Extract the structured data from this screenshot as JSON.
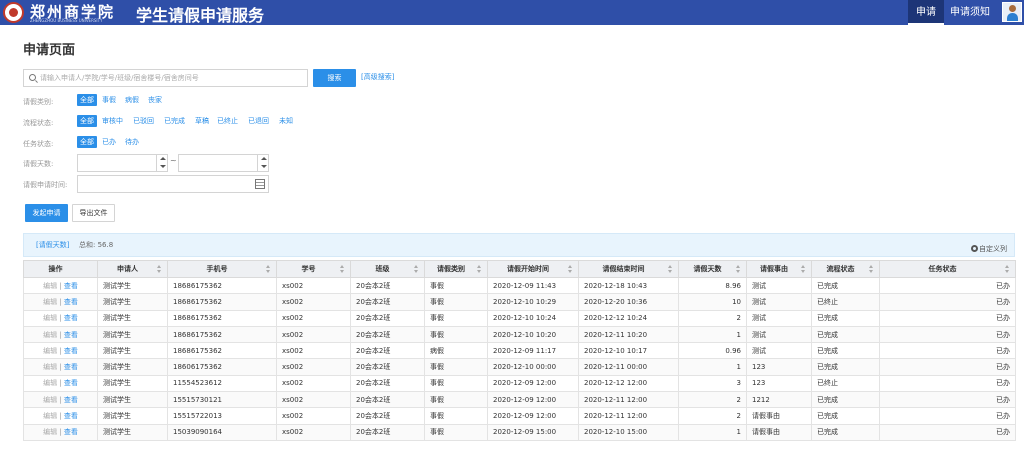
{
  "header": {
    "logo_text": "郑州商学院",
    "logo_subtitle": "ZHENGZHOU BUSINESS UNIVERSITY",
    "app_title": "学生请假申请服务",
    "nav": [
      {
        "label": "申请",
        "active": true
      },
      {
        "label": "申请须知",
        "active": false
      }
    ],
    "brand_color": "#2f4fa8"
  },
  "page": {
    "title": "申请页面",
    "search": {
      "placeholder": "请输入申请人/学院/学号/班级/宿舍楼号/宿舍房间号",
      "button": "搜索",
      "advanced": "[高级搜索]"
    },
    "filters": {
      "leave_type": {
        "label": "请假类别:",
        "options": [
          "全部",
          "事假",
          "病假",
          "丧家"
        ],
        "selected": "全部"
      },
      "flow_status": {
        "label": "流程状态:",
        "options": [
          "全部",
          "审核中",
          "已驳回",
          "已完成",
          "草稿",
          "已终止",
          "已退回",
          "未知"
        ],
        "selected": "全部"
      },
      "task_status": {
        "label": "任务状态:",
        "options": [
          "全部",
          "已办",
          "待办"
        ],
        "selected": "全部"
      },
      "leave_days": {
        "label": "请假天数:",
        "range_separator": "~"
      },
      "apply_time": {
        "label": "请假申请时间:"
      }
    },
    "actions": {
      "apply": "发起申请",
      "export": "导出文件"
    },
    "summary": {
      "link": "[请假天数]",
      "total": "总和: 56.8",
      "custom_columns": "自定义列"
    },
    "table": {
      "columns": [
        "操作",
        "申请人",
        "手机号",
        "学号",
        "班级",
        "请假类别",
        "请假开始时间",
        "请假结束时间",
        "请假天数",
        "请假事由",
        "流程状态",
        "任务状态"
      ],
      "op_edit": "编辑",
      "op_sep": "|",
      "op_view": "查看",
      "rows": [
        [
          "测试学生",
          "18686175362",
          "xs002",
          "20会本2班",
          "事假",
          "2020-12-09 11:43",
          "2020-12-18 10:43",
          "8.96",
          "测试",
          "已完成",
          "已办"
        ],
        [
          "测试学生",
          "18686175362",
          "xs002",
          "20会本2班",
          "事假",
          "2020-12-10 10:29",
          "2020-12-20 10:36",
          "10",
          "测试",
          "已终止",
          "已办"
        ],
        [
          "测试学生",
          "18686175362",
          "xs002",
          "20会本2班",
          "事假",
          "2020-12-10 10:24",
          "2020-12-12 10:24",
          "2",
          "测试",
          "已完成",
          "已办"
        ],
        [
          "测试学生",
          "18686175362",
          "xs002",
          "20会本2班",
          "事假",
          "2020-12-10 10:20",
          "2020-12-11 10:20",
          "1",
          "测试",
          "已完成",
          "已办"
        ],
        [
          "测试学生",
          "18686175362",
          "xs002",
          "20会本2班",
          "病假",
          "2020-12-09 11:17",
          "2020-12-10 10:17",
          "0.96",
          "测试",
          "已完成",
          "已办"
        ],
        [
          "测试学生",
          "18606175362",
          "xs002",
          "20会本2班",
          "事假",
          "2020-12-10 00:00",
          "2020-12-11 00:00",
          "1",
          "123",
          "已完成",
          "已办"
        ],
        [
          "测试学生",
          "11554523612",
          "xs002",
          "20会本2班",
          "事假",
          "2020-12-09 12:00",
          "2020-12-12 12:00",
          "3",
          "123",
          "已终止",
          "已办"
        ],
        [
          "测试学生",
          "15515730121",
          "xs002",
          "20会本2班",
          "事假",
          "2020-12-09 12:00",
          "2020-12-11 12:00",
          "2",
          "1212",
          "已完成",
          "已办"
        ],
        [
          "测试学生",
          "15515722013",
          "xs002",
          "20会本2班",
          "事假",
          "2020-12-09 12:00",
          "2020-12-11 12:00",
          "2",
          "请假事由",
          "已完成",
          "已办"
        ],
        [
          "测试学生",
          "15039090164",
          "xs002",
          "20会本2班",
          "事假",
          "2020-12-09 15:00",
          "2020-12-10 15:00",
          "1",
          "请假事由",
          "已完成",
          "已办"
        ]
      ]
    },
    "accent_color": "#2b8fe8"
  }
}
